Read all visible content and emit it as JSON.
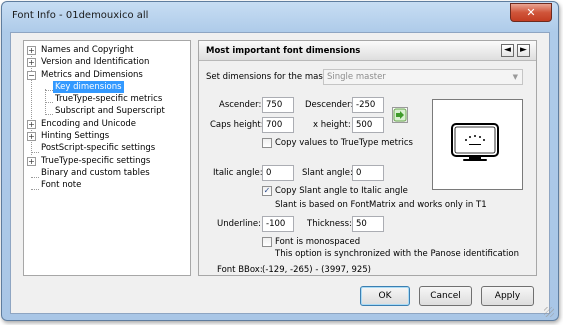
{
  "window": {
    "title": "Font Info - 01demouxico all",
    "close_glyph": "✕"
  },
  "tree": {
    "items": [
      {
        "label": "Names and Copyright",
        "expander": "+"
      },
      {
        "label": "Version and Identification",
        "expander": "+"
      },
      {
        "label": "Metrics and Dimensions",
        "expander": "−"
      },
      {
        "label": "Key dimensions"
      },
      {
        "label": "TrueType-specific metrics"
      },
      {
        "label": "Subscript and Superscript"
      },
      {
        "label": "Encoding and Unicode",
        "expander": "+"
      },
      {
        "label": "Hinting Settings",
        "expander": "+"
      },
      {
        "label": "PostScript-specific settings"
      },
      {
        "label": "TrueType-specific settings",
        "expander": "+"
      },
      {
        "label": "Binary and custom tables"
      },
      {
        "label": "Font note"
      }
    ]
  },
  "panel": {
    "title": "Most important font dimensions",
    "prev": "◄",
    "next": "►",
    "master_label": "Set dimensions for the master:",
    "master_value": "Single master",
    "ascender_label": "Ascender:",
    "ascender_value": "750",
    "descender_label": "Descender:",
    "descender_value": "-250",
    "caps_label": "Caps height:",
    "caps_value": "700",
    "xheight_label": "x height:",
    "xheight_value": "500",
    "copy_tt_label": "Copy values to TrueType metrics",
    "italic_label": "Italic angle:",
    "italic_value": "0",
    "slant_label": "Slant angle:",
    "slant_value": "0",
    "copy_slant_label": "Copy Slant angle to Italic angle",
    "copy_slant_checked": true,
    "slant_note": "Slant is based on FontMatrix and works only in T1",
    "underline_label": "Underline:",
    "underline_value": "-100",
    "thickness_label": "Thickness:",
    "thickness_value": "50",
    "mono_label": "Font is monospaced",
    "mono_note": "This option is synchronized with the Panose identification",
    "bbox_label": "Font BBox:",
    "bbox_value": "(-129, -265) - (3997, 925)",
    "check_glyph": "✓"
  },
  "buttons": {
    "ok": "OK",
    "cancel": "Cancel",
    "apply": "Apply"
  },
  "colors": {
    "selection": "#3399ff",
    "title_bar": "#aecbe9",
    "close": "#c33d22"
  }
}
